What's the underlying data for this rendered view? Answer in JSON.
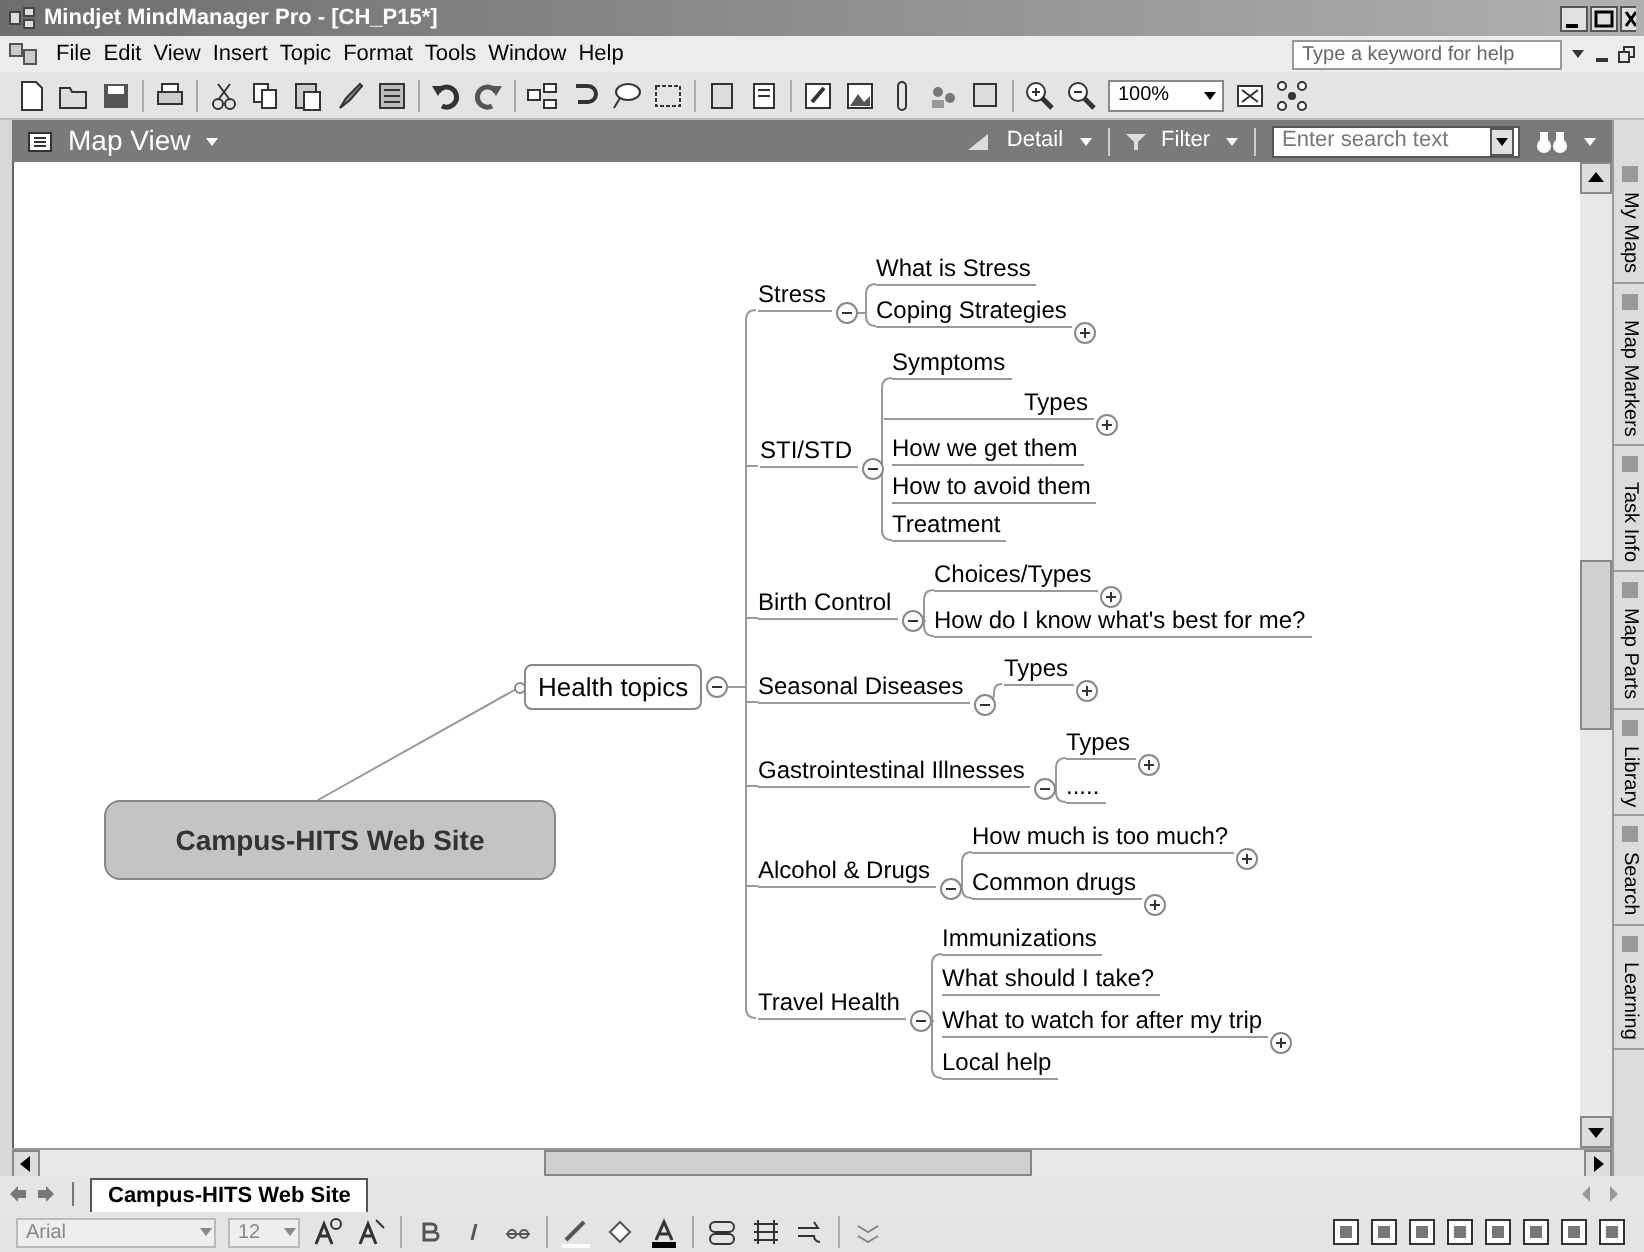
{
  "window": {
    "title": "Mindjet MindManager Pro - [CH_P15*]"
  },
  "menu": [
    "File",
    "Edit",
    "View",
    "Insert",
    "Topic",
    "Format",
    "Tools",
    "Window",
    "Help"
  ],
  "help_search": {
    "placeholder": "Type a keyword for help"
  },
  "toolbar": {
    "zoom": "100%"
  },
  "map_view": {
    "title": "Map View",
    "detail": "Detail",
    "filter": "Filter",
    "search": {
      "placeholder": "Enter search text"
    }
  },
  "map": {
    "central_topic": "Campus-HITS Web Site",
    "main_topic": {
      "label": "Health topics",
      "expanded": true,
      "children": [
        {
          "label": "Stress",
          "expanded": true,
          "children": [
            {
              "label": "What is Stress"
            },
            {
              "label": "Coping Strategies",
              "expanded": false
            }
          ]
        },
        {
          "label": "STI/STD",
          "expanded": true,
          "children": [
            {
              "label": "Symptoms"
            },
            {
              "label": "Types",
              "expanded": false
            },
            {
              "label": "How we get them"
            },
            {
              "label": "How to avoid them"
            },
            {
              "label": "Treatment"
            }
          ]
        },
        {
          "label": "Birth Control",
          "expanded": true,
          "children": [
            {
              "label": "Choices/Types",
              "expanded": false
            },
            {
              "label": "How do I know what's best for me?"
            }
          ]
        },
        {
          "label": "Seasonal Diseases",
          "expanded": true,
          "children": [
            {
              "label": "Types",
              "expanded": false
            }
          ]
        },
        {
          "label": "Gastrointestinal Illnesses",
          "expanded": true,
          "children": [
            {
              "label": "Types",
              "expanded": false
            },
            {
              "label": "....."
            }
          ]
        },
        {
          "label": "Alcohol & Drugs",
          "expanded": true,
          "children": [
            {
              "label": "How much is too much?",
              "expanded": false
            },
            {
              "label": "Common drugs",
              "expanded": false
            }
          ]
        },
        {
          "label": "Travel Health",
          "expanded": true,
          "children": [
            {
              "label": "Immunizations"
            },
            {
              "label": "What should I take?"
            },
            {
              "label": "What to watch for after my trip",
              "expanded": false
            },
            {
              "label": "Local help"
            }
          ]
        }
      ]
    }
  },
  "side_tabs": [
    "My Maps",
    "Map Markers",
    "Task Info",
    "Map Parts",
    "Library",
    "Search",
    "Learning"
  ],
  "map_tabs": [
    {
      "label": "Campus-HITS Web Site",
      "selected": true
    }
  ],
  "format_bar": {
    "font": "Arial",
    "size": "12"
  }
}
